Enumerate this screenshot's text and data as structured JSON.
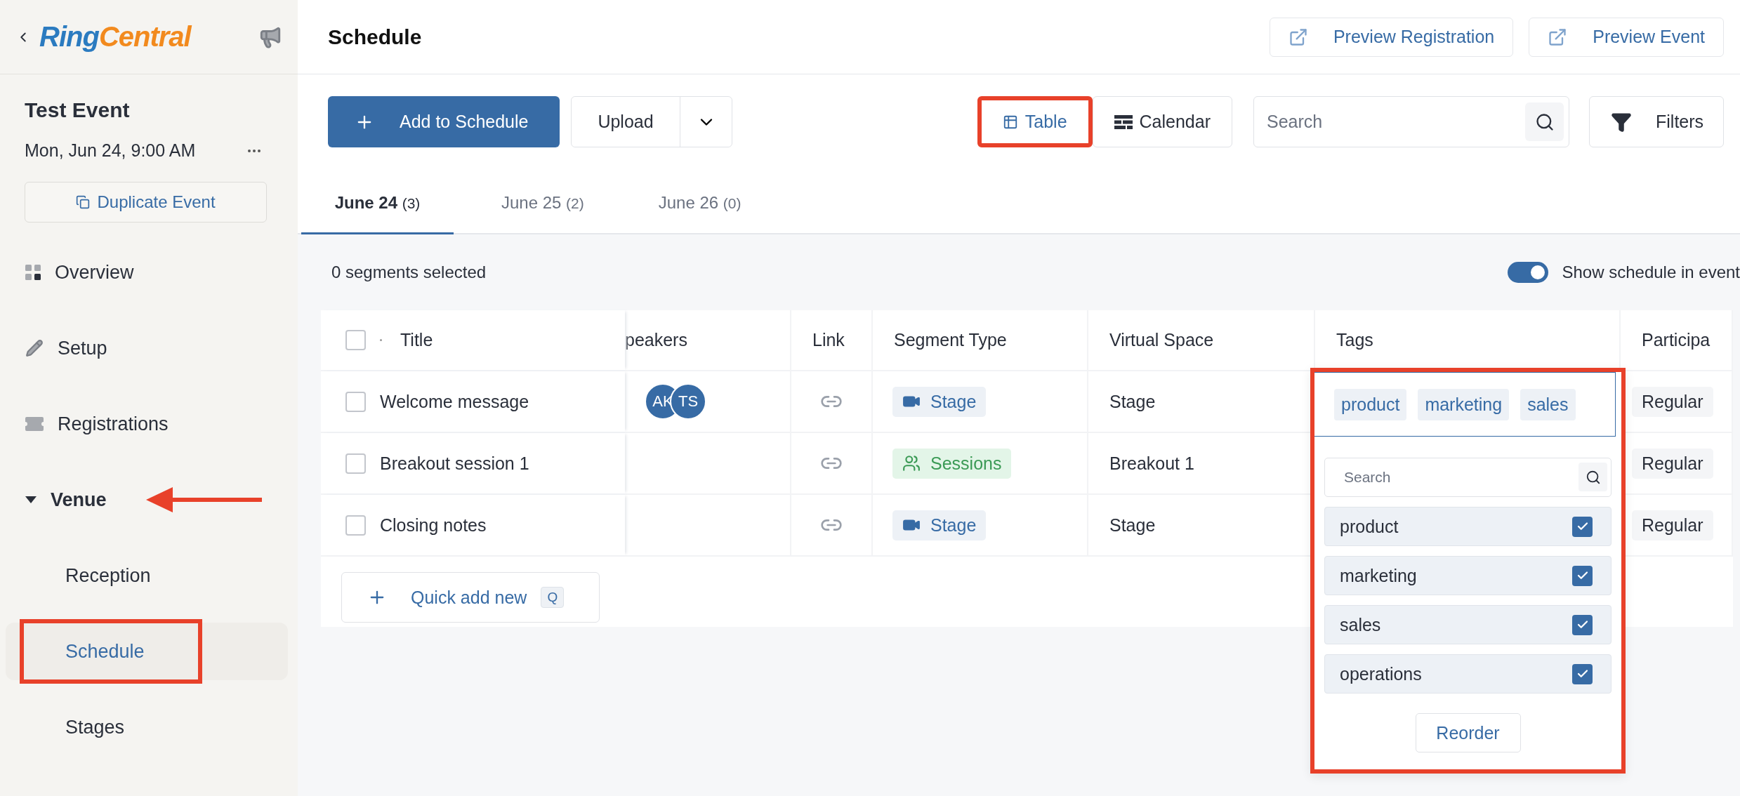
{
  "sidebar": {
    "logo": {
      "part_1": "Ring",
      "part_2": "Central"
    },
    "event_title": "Test Event",
    "event_date": "Mon, Jun 24, 9:00 AM",
    "duplicate_button": "Duplicate Event",
    "items": [
      {
        "label": "Overview",
        "kind": "top",
        "selected": false,
        "highlighted": false,
        "arrow": false
      },
      {
        "label": "Setup",
        "kind": "top",
        "selected": false,
        "highlighted": false,
        "arrow": false
      },
      {
        "label": "Registrations",
        "kind": "top",
        "selected": false,
        "highlighted": false,
        "arrow": false
      },
      {
        "label": "Venue",
        "kind": "group",
        "selected": false,
        "expanded": true,
        "highlighted": false,
        "arrow": true
      },
      {
        "label": "Reception",
        "kind": "sub",
        "selected": false,
        "highlighted": false,
        "arrow": false
      },
      {
        "label": "Schedule",
        "kind": "sub",
        "selected": true,
        "highlighted": true,
        "arrow": false
      },
      {
        "label": "Stages",
        "kind": "sub",
        "selected": false,
        "highlighted": false,
        "arrow": false
      }
    ]
  },
  "header": {
    "title": "Schedule",
    "buttons": [
      "Preview Registration",
      "Preview Event"
    ]
  },
  "toolbar": {
    "add_button": "Add to Schedule",
    "upload_button": "Upload",
    "views": [
      {
        "label": "Table",
        "selected": true,
        "highlighted": true
      },
      {
        "label": "Calendar",
        "selected": false,
        "highlighted": false
      }
    ],
    "search_placeholder": "Search",
    "filters_button": "Filters"
  },
  "tabs": [
    {
      "label": "June 24",
      "count": "(3)",
      "selected": true
    },
    {
      "label": "June 25",
      "count": "(2)",
      "selected": false
    },
    {
      "label": "June 26",
      "count": "(0)",
      "selected": false
    }
  ],
  "selection_text": "0 segments selected",
  "show_schedule": {
    "label": "Show schedule in event",
    "on": true
  },
  "table": {
    "select_all_checked": false,
    "columns": [
      "Title",
      "peakers",
      "Link",
      "Segment Type",
      "Virtual Space",
      "Tags",
      "Participa"
    ],
    "rows": [
      {
        "title": "Welcome message",
        "checked": false,
        "speakers": [
          "AK",
          "TS"
        ],
        "segment_type": {
          "label": "Stage",
          "kind": "stage"
        },
        "virtual_space": "Stage",
        "participant": "Regular"
      },
      {
        "title": "Breakout session 1",
        "checked": false,
        "speakers": [],
        "segment_type": {
          "label": "Sessions",
          "kind": "sessions"
        },
        "virtual_space": "Breakout 1",
        "participant": "Regular"
      },
      {
        "title": "Closing notes",
        "checked": false,
        "speakers": [],
        "segment_type": {
          "label": "Stage",
          "kind": "stage"
        },
        "virtual_space": "Stage",
        "participant": "Regular"
      }
    ],
    "quick_add": {
      "label": "Quick add new",
      "shortcut": "Q"
    }
  },
  "tag_editor": {
    "highlighted": true,
    "chips": [
      "product",
      "marketing",
      "sales"
    ],
    "search_placeholder": "Search",
    "options": [
      {
        "label": "product",
        "checked": true
      },
      {
        "label": "marketing",
        "checked": true
      },
      {
        "label": "sales",
        "checked": true
      },
      {
        "label": "operations",
        "checked": true
      }
    ],
    "reorder_button": "Reorder"
  }
}
